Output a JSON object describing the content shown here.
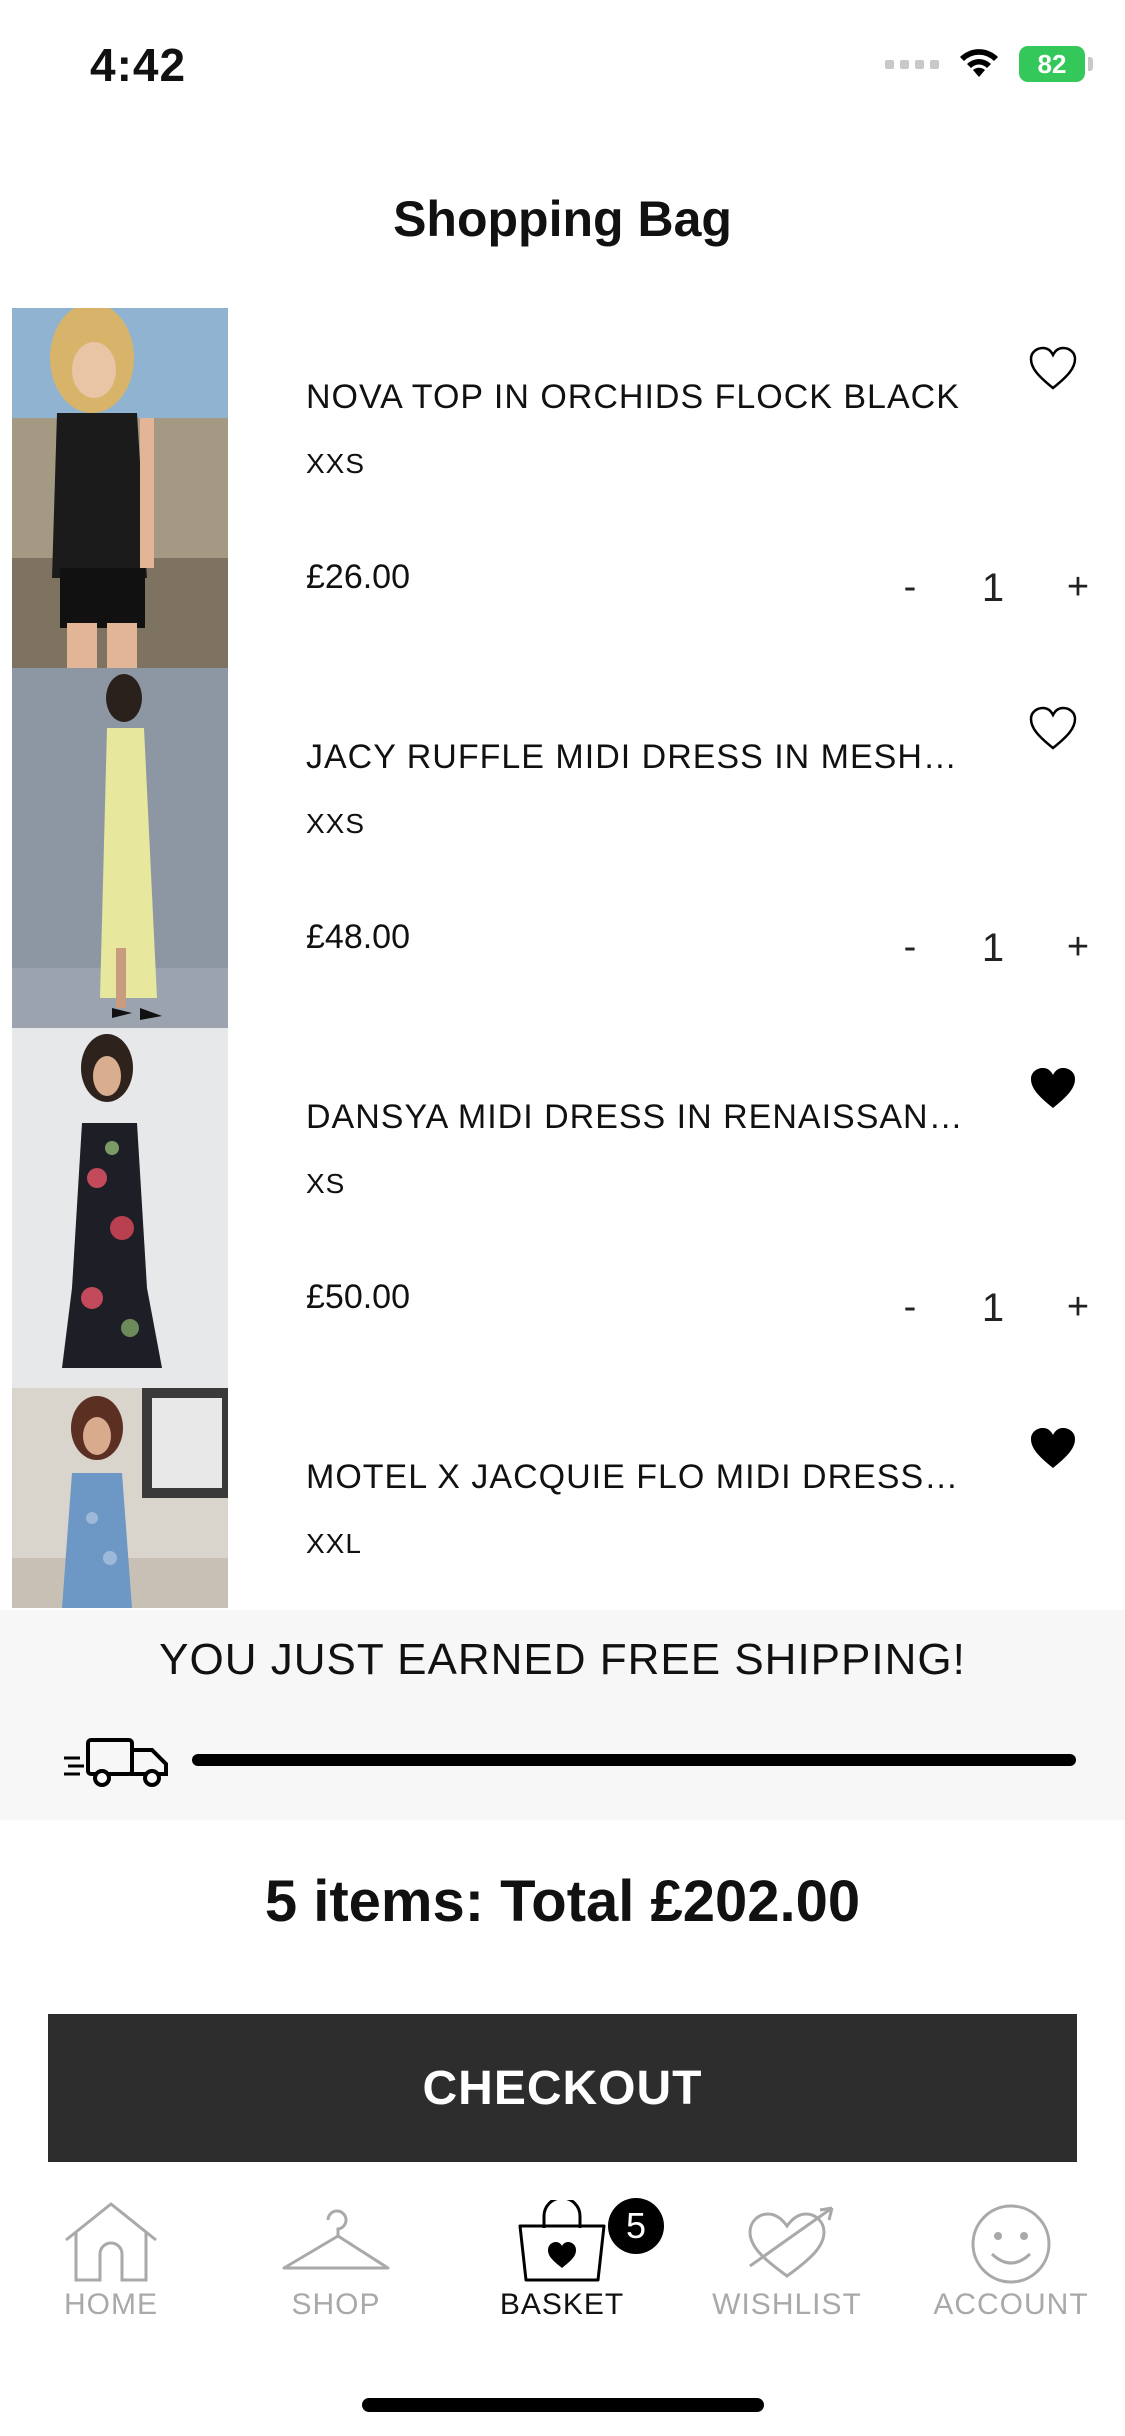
{
  "status_bar": {
    "time": "4:42",
    "battery": "82"
  },
  "header": {
    "title": "Shopping Bag"
  },
  "items": [
    {
      "name": "NOVA TOP IN ORCHIDS FLOCK BLACK",
      "size": "XXS",
      "price": "£26.00",
      "quantity": "1",
      "wishlisted": false
    },
    {
      "name": "JACY RUFFLE MIDI DRESS IN MESH L...",
      "size": "XXS",
      "price": "£48.00",
      "quantity": "1",
      "wishlisted": false
    },
    {
      "name": "DANSYA MIDI DRESS IN RENAISSANC...",
      "size": "XS",
      "price": "£50.00",
      "quantity": "1",
      "wishlisted": true
    },
    {
      "name": "MOTEL X JACQUIE FLO MIDI DRESS I...",
      "size": "XXL",
      "price": "",
      "quantity": "",
      "wishlisted": true
    }
  ],
  "quantity_controls": {
    "minus": "-",
    "plus": "+"
  },
  "shipping": {
    "message": "YOU JUST EARNED FREE SHIPPING!",
    "progress": 1.0
  },
  "summary": {
    "total_text": "5 items: Total £202.00"
  },
  "checkout": {
    "label": "CHECKOUT"
  },
  "tab_bar": {
    "tabs": [
      {
        "label": "HOME",
        "icon": "house-icon"
      },
      {
        "label": "SHOP",
        "icon": "hanger-icon"
      },
      {
        "label": "BASKET",
        "icon": "basket-icon"
      },
      {
        "label": "WISHLIST",
        "icon": "heart-arrow-icon"
      },
      {
        "label": "ACCOUNT",
        "icon": "smiley-icon"
      }
    ],
    "active": "BASKET",
    "basket_badge": "5"
  },
  "colors": {
    "checkout_bg": "#2d2d2d",
    "banner_bg": "#f7f7f7",
    "inactive_tab": "#a9a9a9",
    "battery": "#34c759"
  }
}
